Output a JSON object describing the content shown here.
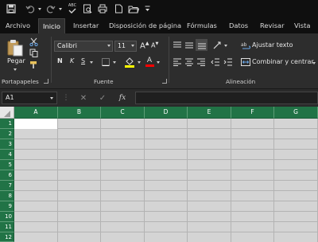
{
  "quick_access": {
    "icons": [
      "save-icon",
      "undo-icon",
      "undo-dropdown-icon",
      "redo-icon",
      "redo-dropdown-icon",
      "spelling-icon",
      "print-preview-icon",
      "quick-print-icon",
      "new-document-icon",
      "open-folder-icon",
      "customize-dropdown-icon"
    ],
    "spelling_label": "ABC"
  },
  "tabs": [
    {
      "label": "Archivo",
      "active": false
    },
    {
      "label": "Inicio",
      "active": true
    },
    {
      "label": "Insertar",
      "active": false
    },
    {
      "label": "Disposición de página",
      "active": false
    },
    {
      "label": "Fórmulas",
      "active": false
    },
    {
      "label": "Datos",
      "active": false
    },
    {
      "label": "Revisar",
      "active": false
    },
    {
      "label": "Vista",
      "active": false
    }
  ],
  "ribbon": {
    "clipboard": {
      "group_label": "Portapapeles",
      "paste_label": "Pegar"
    },
    "font": {
      "group_label": "Fuente",
      "font_name": "Calibri",
      "font_size": "11",
      "grow_label": "A",
      "shrink_label": "A",
      "bold_label": "N",
      "italic_label": "K",
      "underline_label": "S",
      "font_color_label": "A",
      "highlight_color": "#ffff00",
      "font_color": "#ff0000"
    },
    "alignment": {
      "group_label": "Alineación",
      "wrap_text_label": "Ajustar texto",
      "merge_center_label": "Combinar y centrar"
    }
  },
  "formula_bar": {
    "name_box": "A1",
    "cancel_symbol": "✕",
    "enter_symbol": "✓",
    "function_symbol": "fx",
    "formula_value": ""
  },
  "grid": {
    "columns": [
      "A",
      "B",
      "C",
      "D",
      "E",
      "F",
      "G"
    ],
    "rows": [
      "1",
      "2",
      "3",
      "4",
      "5",
      "6",
      "7",
      "8",
      "9",
      "10",
      "11",
      "12"
    ],
    "selected_cell": "A1",
    "header_color": "#217346"
  }
}
